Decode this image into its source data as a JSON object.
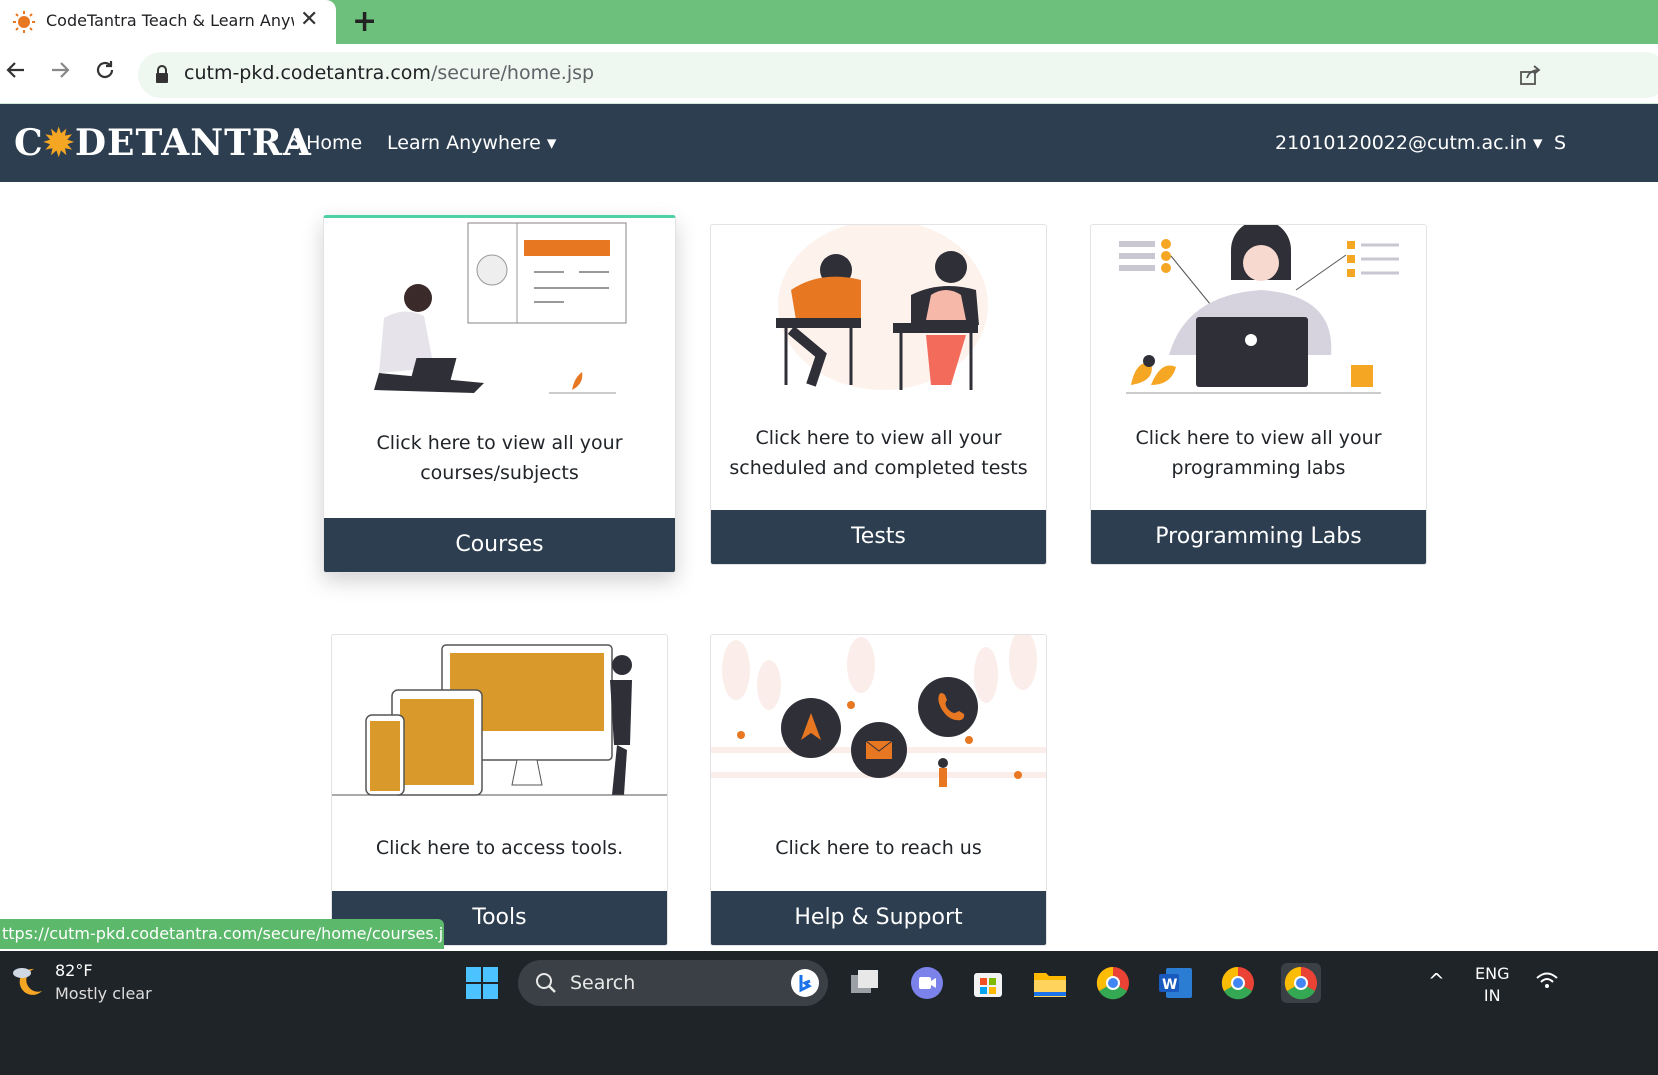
{
  "browser": {
    "tab_title": "CodeTantra Teach & Learn Anywhere",
    "tab_close": "✕",
    "new_tab": "+",
    "url_host": "cutm-pkd.codetantra.com",
    "url_path": "/secure/home.jsp"
  },
  "nav": {
    "brand_c": "C",
    "brand_sun": "✹",
    "brand_rest": "DETANTRA",
    "home_icon": "⌂",
    "home": "Home",
    "learn": "Learn Anywhere ▾",
    "user": "21010120022@cutm.ac.in ▾",
    "cut": "S"
  },
  "cards": [
    {
      "desc_line1": "Click here to view all your",
      "desc_line2": "courses/subjects",
      "title": "Courses"
    },
    {
      "desc_line1": "Click here to view all your",
      "desc_line2": "scheduled and completed tests",
      "title": "Tests"
    },
    {
      "desc_line1": "Click here to view all your",
      "desc_line2": "programming labs",
      "title": "Programming Labs"
    },
    {
      "desc_line1": "Click here to access tools.",
      "desc_line2": "",
      "title": "Tools"
    },
    {
      "desc_line1": "Click here to reach us",
      "desc_line2": "",
      "title": "Help & Support"
    }
  ],
  "status_url": "ttps://cutm-pkd.codetantra.com/secure/home/courses.jsp",
  "taskbar": {
    "weather_temp": "82°F",
    "weather_desc": "Mostly clear",
    "search": "Search",
    "lang1": "ENG",
    "lang2": "IN",
    "tray_chevron": "^"
  },
  "colors": {
    "navbar": "#2c3e50",
    "accent_orange": "#e87722",
    "mustard": "#d99a2b",
    "tab_green": "#6dbf7c"
  }
}
